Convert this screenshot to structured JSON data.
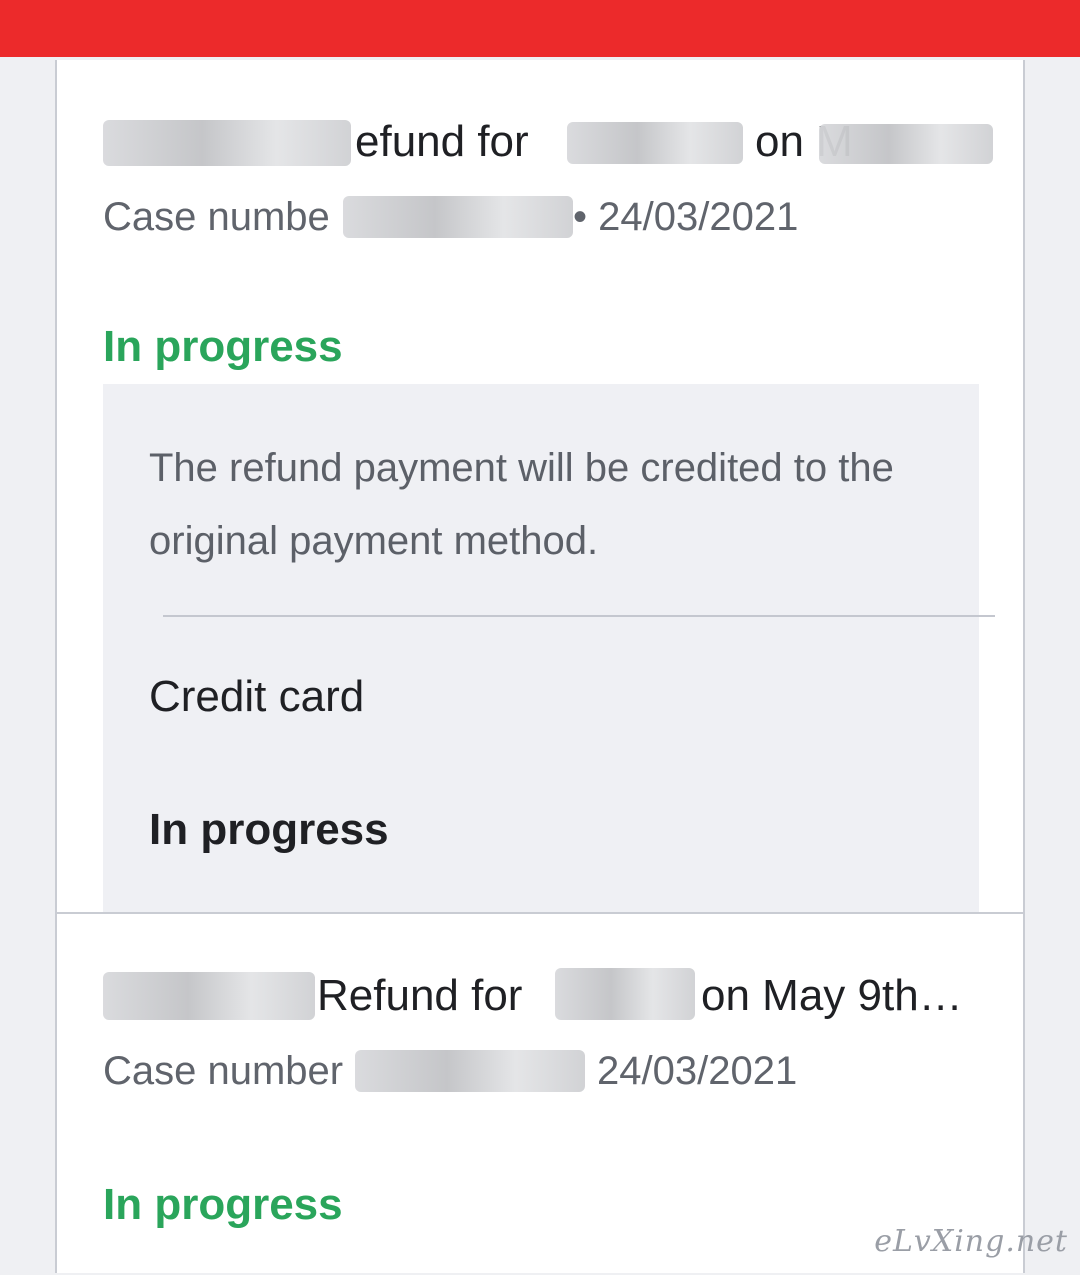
{
  "case_1": {
    "title_part_1": "efund for",
    "title_part_2": "on M",
    "case_label": "Case numbe",
    "date": "• 24/03/2021",
    "status": "In progress",
    "refund_panel": {
      "message": "The refund payment will be credited to the original payment method.",
      "method": "Credit card",
      "method_status": "In progress"
    }
  },
  "case_2": {
    "title_part_1": "Refund for",
    "title_part_2": "on May 9th…",
    "case_label": "Case number",
    "date": "24/03/2021",
    "status": "In progress"
  },
  "watermark": "eLvXing.net",
  "colors": {
    "top_bar": "#ec2a2b",
    "status_green": "#2aa55b",
    "panel_bg": "#eff0f4"
  }
}
